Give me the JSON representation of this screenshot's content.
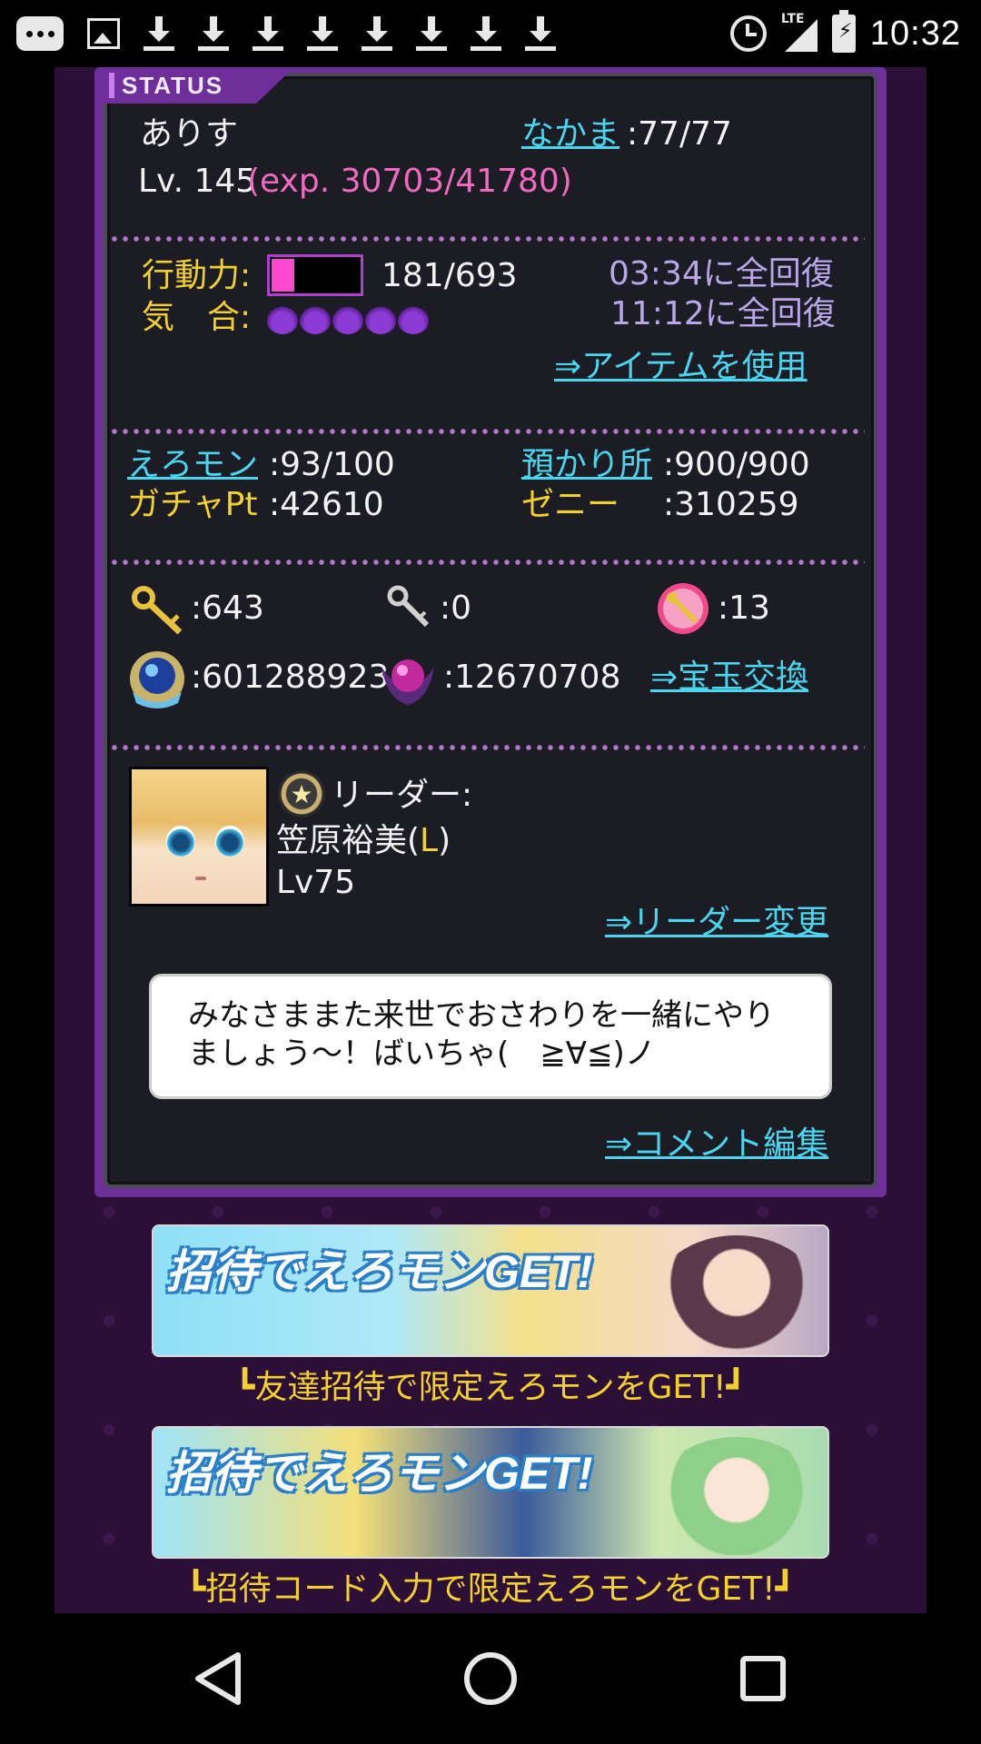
{
  "statusbar": {
    "time": "10:32",
    "network": "LTE",
    "download_count": 8
  },
  "panel": {
    "tab_label": "STATUS",
    "player_name": "ありす",
    "nakama_label": "なかま",
    "nakama_value": ":77/77",
    "level": "Lv. 145",
    "exp": "(exp. 30703/41780)",
    "action_label": "行動力:",
    "action_value": "181/693",
    "action_fraction": 0.26,
    "action_recover": "03:34に全回復",
    "kiai_label": "気　合:",
    "kiai_flames": 5,
    "kiai_recover": "11:12に全回復",
    "use_item_link": "⇒アイテムを使用",
    "eromon_label": "えろモン",
    "eromon_value": ":93/100",
    "storage_label": "預かり所",
    "storage_value": ":900/900",
    "gacha_label": "ガチャPt",
    "gacha_value": ":42610",
    "zeni_label": "ゼニー　",
    "zeni_value": ":310259",
    "gold_key_count": ":643",
    "silver_key_count": ":0",
    "ticket_count": ":13",
    "blue_orb_count": ":601288923",
    "purple_orb_count": ":12670708",
    "exchange_link": "⇒宝玉交換",
    "leader_label": "リーダー:",
    "leader_name": "笠原裕美(",
    "leader_rarity": "L",
    "leader_name_close": ")",
    "leader_level": "Lv75",
    "change_leader_link": "⇒リーダー変更",
    "comment": "みなさままた来世でおさわりを一緒にやりましょう〜！ばいちゃ(　≧∀≦)ノ",
    "edit_comment_link": "⇒コメント編集"
  },
  "banners": [
    {
      "title": "招待でえろモンGET!",
      "caption": "┗友達招待で限定えろモンをGET!┛"
    },
    {
      "title": "招待でえろモンGET!",
      "caption": "┗招待コード入力で限定えろモンをGET!┛"
    }
  ],
  "colors": {
    "accent_purple": "#6f2f9a",
    "link_cyan": "#4ad6ef",
    "label_yellow": "#f3d12c",
    "exp_pink": "#f06bc0",
    "bar_fill": "#ff48d2"
  },
  "navbar": {
    "back_icon": "back-triangle-icon",
    "home_icon": "home-circle-icon",
    "recents_icon": "recents-square-icon"
  }
}
